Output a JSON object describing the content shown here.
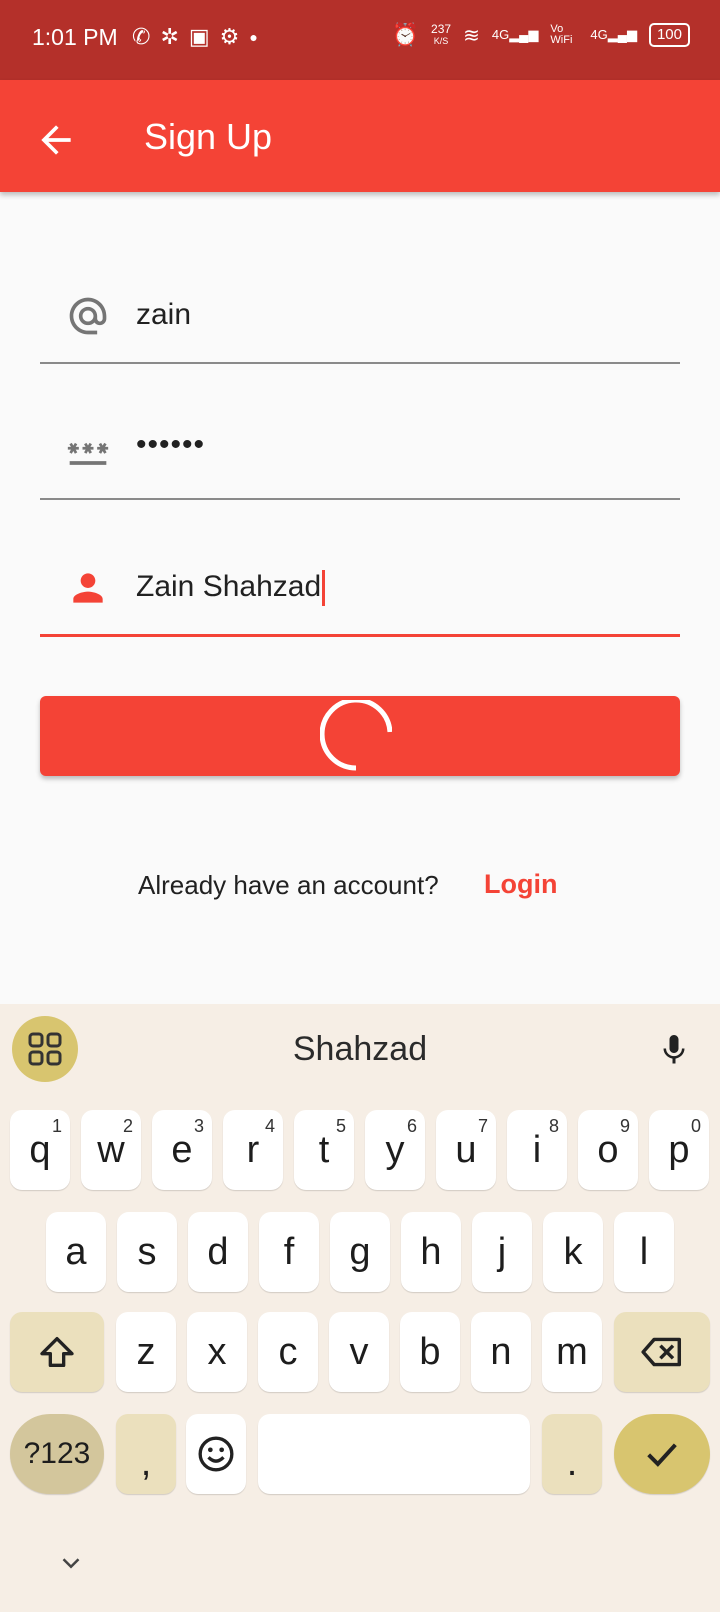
{
  "status_bar": {
    "time": "1:01 PM",
    "speed_value": "237",
    "speed_unit": "K/S",
    "net1": "4G",
    "volte": "Vo WiFi",
    "net2": "4G",
    "battery": "100"
  },
  "app_bar": {
    "title": "Sign Up"
  },
  "form": {
    "email_value": "zain",
    "password_value": "••••••",
    "name_value": "Zain Shahzad"
  },
  "footer": {
    "prompt": "Already have an account?",
    "login_label": "Login"
  },
  "keyboard": {
    "suggestion": "Shahzad",
    "row1": [
      {
        "k": "q",
        "h": "1"
      },
      {
        "k": "w",
        "h": "2"
      },
      {
        "k": "e",
        "h": "3"
      },
      {
        "k": "r",
        "h": "4"
      },
      {
        "k": "t",
        "h": "5"
      },
      {
        "k": "y",
        "h": "6"
      },
      {
        "k": "u",
        "h": "7"
      },
      {
        "k": "i",
        "h": "8"
      },
      {
        "k": "o",
        "h": "9"
      },
      {
        "k": "p",
        "h": "0"
      }
    ],
    "row2": [
      "a",
      "s",
      "d",
      "f",
      "g",
      "h",
      "j",
      "k",
      "l"
    ],
    "row3": [
      "z",
      "x",
      "c",
      "v",
      "b",
      "n",
      "m"
    ],
    "symbols_label": "?123",
    "comma": ",",
    "period": "."
  },
  "colors": {
    "primary": "#f44336",
    "status_bar": "#b4302a",
    "keyboard_bg": "#f6eee5",
    "accent_key": "#d8c56f"
  }
}
